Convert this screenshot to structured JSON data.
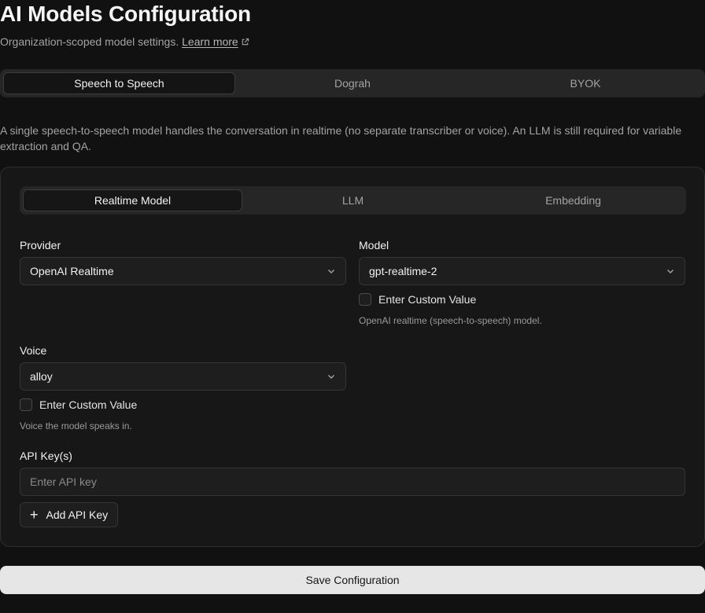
{
  "header": {
    "title": "AI Models Configuration",
    "subtitle": "Organization-scoped model settings.",
    "learn_more": "Learn more"
  },
  "mode_tabs": [
    {
      "label": "Speech to Speech",
      "active": true
    },
    {
      "label": "Dograh",
      "active": false
    },
    {
      "label": "BYOK",
      "active": false
    }
  ],
  "description": "A single speech-to-speech model handles the conversation in realtime (no separate transcriber or voice). An LLM is still required for variable extraction and QA.",
  "config_tabs": [
    {
      "label": "Realtime Model",
      "active": true
    },
    {
      "label": "LLM",
      "active": false
    },
    {
      "label": "Embedding",
      "active": false
    }
  ],
  "provider": {
    "label": "Provider",
    "value": "OpenAI Realtime"
  },
  "model": {
    "label": "Model",
    "value": "gpt-realtime-2",
    "custom_label": "Enter Custom Value",
    "custom_checked": false,
    "help": "OpenAI realtime (speech-to-speech) model."
  },
  "voice": {
    "label": "Voice",
    "value": "alloy",
    "custom_label": "Enter Custom Value",
    "custom_checked": false,
    "help": "Voice the model speaks in."
  },
  "api_keys": {
    "label": "API Key(s)",
    "placeholder": "Enter API key",
    "value": "",
    "add_label": "Add API Key"
  },
  "save_label": "Save Configuration",
  "icons": {
    "external_link": "external-link-icon",
    "chevron": "chevron-down-icon",
    "plus": "plus-icon"
  },
  "colors": {
    "background": "#111111",
    "card": "#171717",
    "tab_bar": "#262626",
    "save_button": "#e6e6e6"
  }
}
